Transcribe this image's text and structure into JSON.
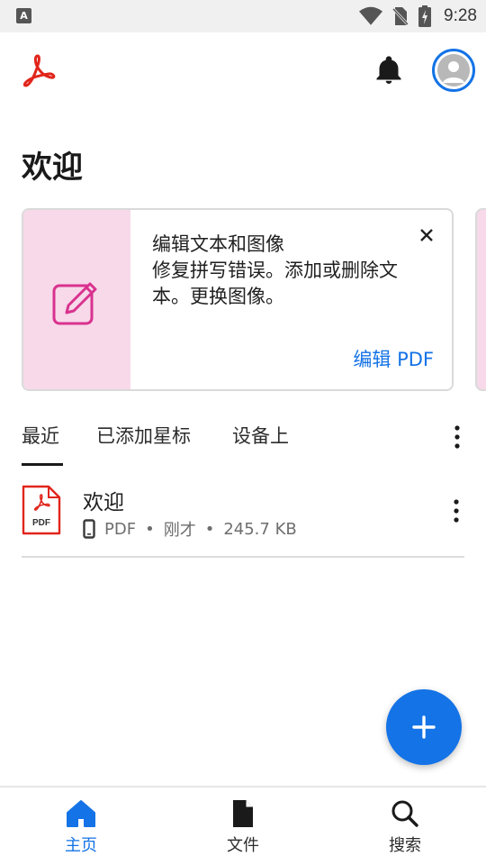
{
  "status_bar": {
    "time": "9:28",
    "left_badge": "A",
    "icons": [
      "wifi-icon",
      "no-sim-icon",
      "battery-charging-icon"
    ]
  },
  "app_bar": {
    "logo": "adobe-acrobat-logo",
    "notification_icon": "bell-icon",
    "avatar_icon": "account-avatar"
  },
  "page": {
    "title": "欢迎"
  },
  "promo_card": {
    "icon": "edit-pencil-icon",
    "title": "编辑文本和图像",
    "description": "修复拼写错误。添加或删除文本。更换图像。",
    "action_label": "编辑 PDF",
    "close_icon": "close-icon",
    "art_color": "#f7d9e9",
    "icon_color": "#d9328f"
  },
  "tabs": {
    "items": [
      {
        "label": "最近",
        "active": true
      },
      {
        "label": "已添加星标",
        "active": false
      },
      {
        "label": "设备上",
        "active": false
      }
    ]
  },
  "files": [
    {
      "name": "欢迎",
      "type": "PDF",
      "location_icon": "phone-icon",
      "modified": "刚才",
      "size": "245.7 KB"
    }
  ],
  "fab": {
    "icon": "plus-icon"
  },
  "bottom_nav": {
    "items": [
      {
        "label": "主页",
        "icon": "home-icon",
        "active": true
      },
      {
        "label": "文件",
        "icon": "file-icon",
        "active": false
      },
      {
        "label": "搜索",
        "icon": "search-icon",
        "active": false
      }
    ]
  },
  "colors": {
    "accent": "#1473e6",
    "brand_red": "#e1251b"
  }
}
